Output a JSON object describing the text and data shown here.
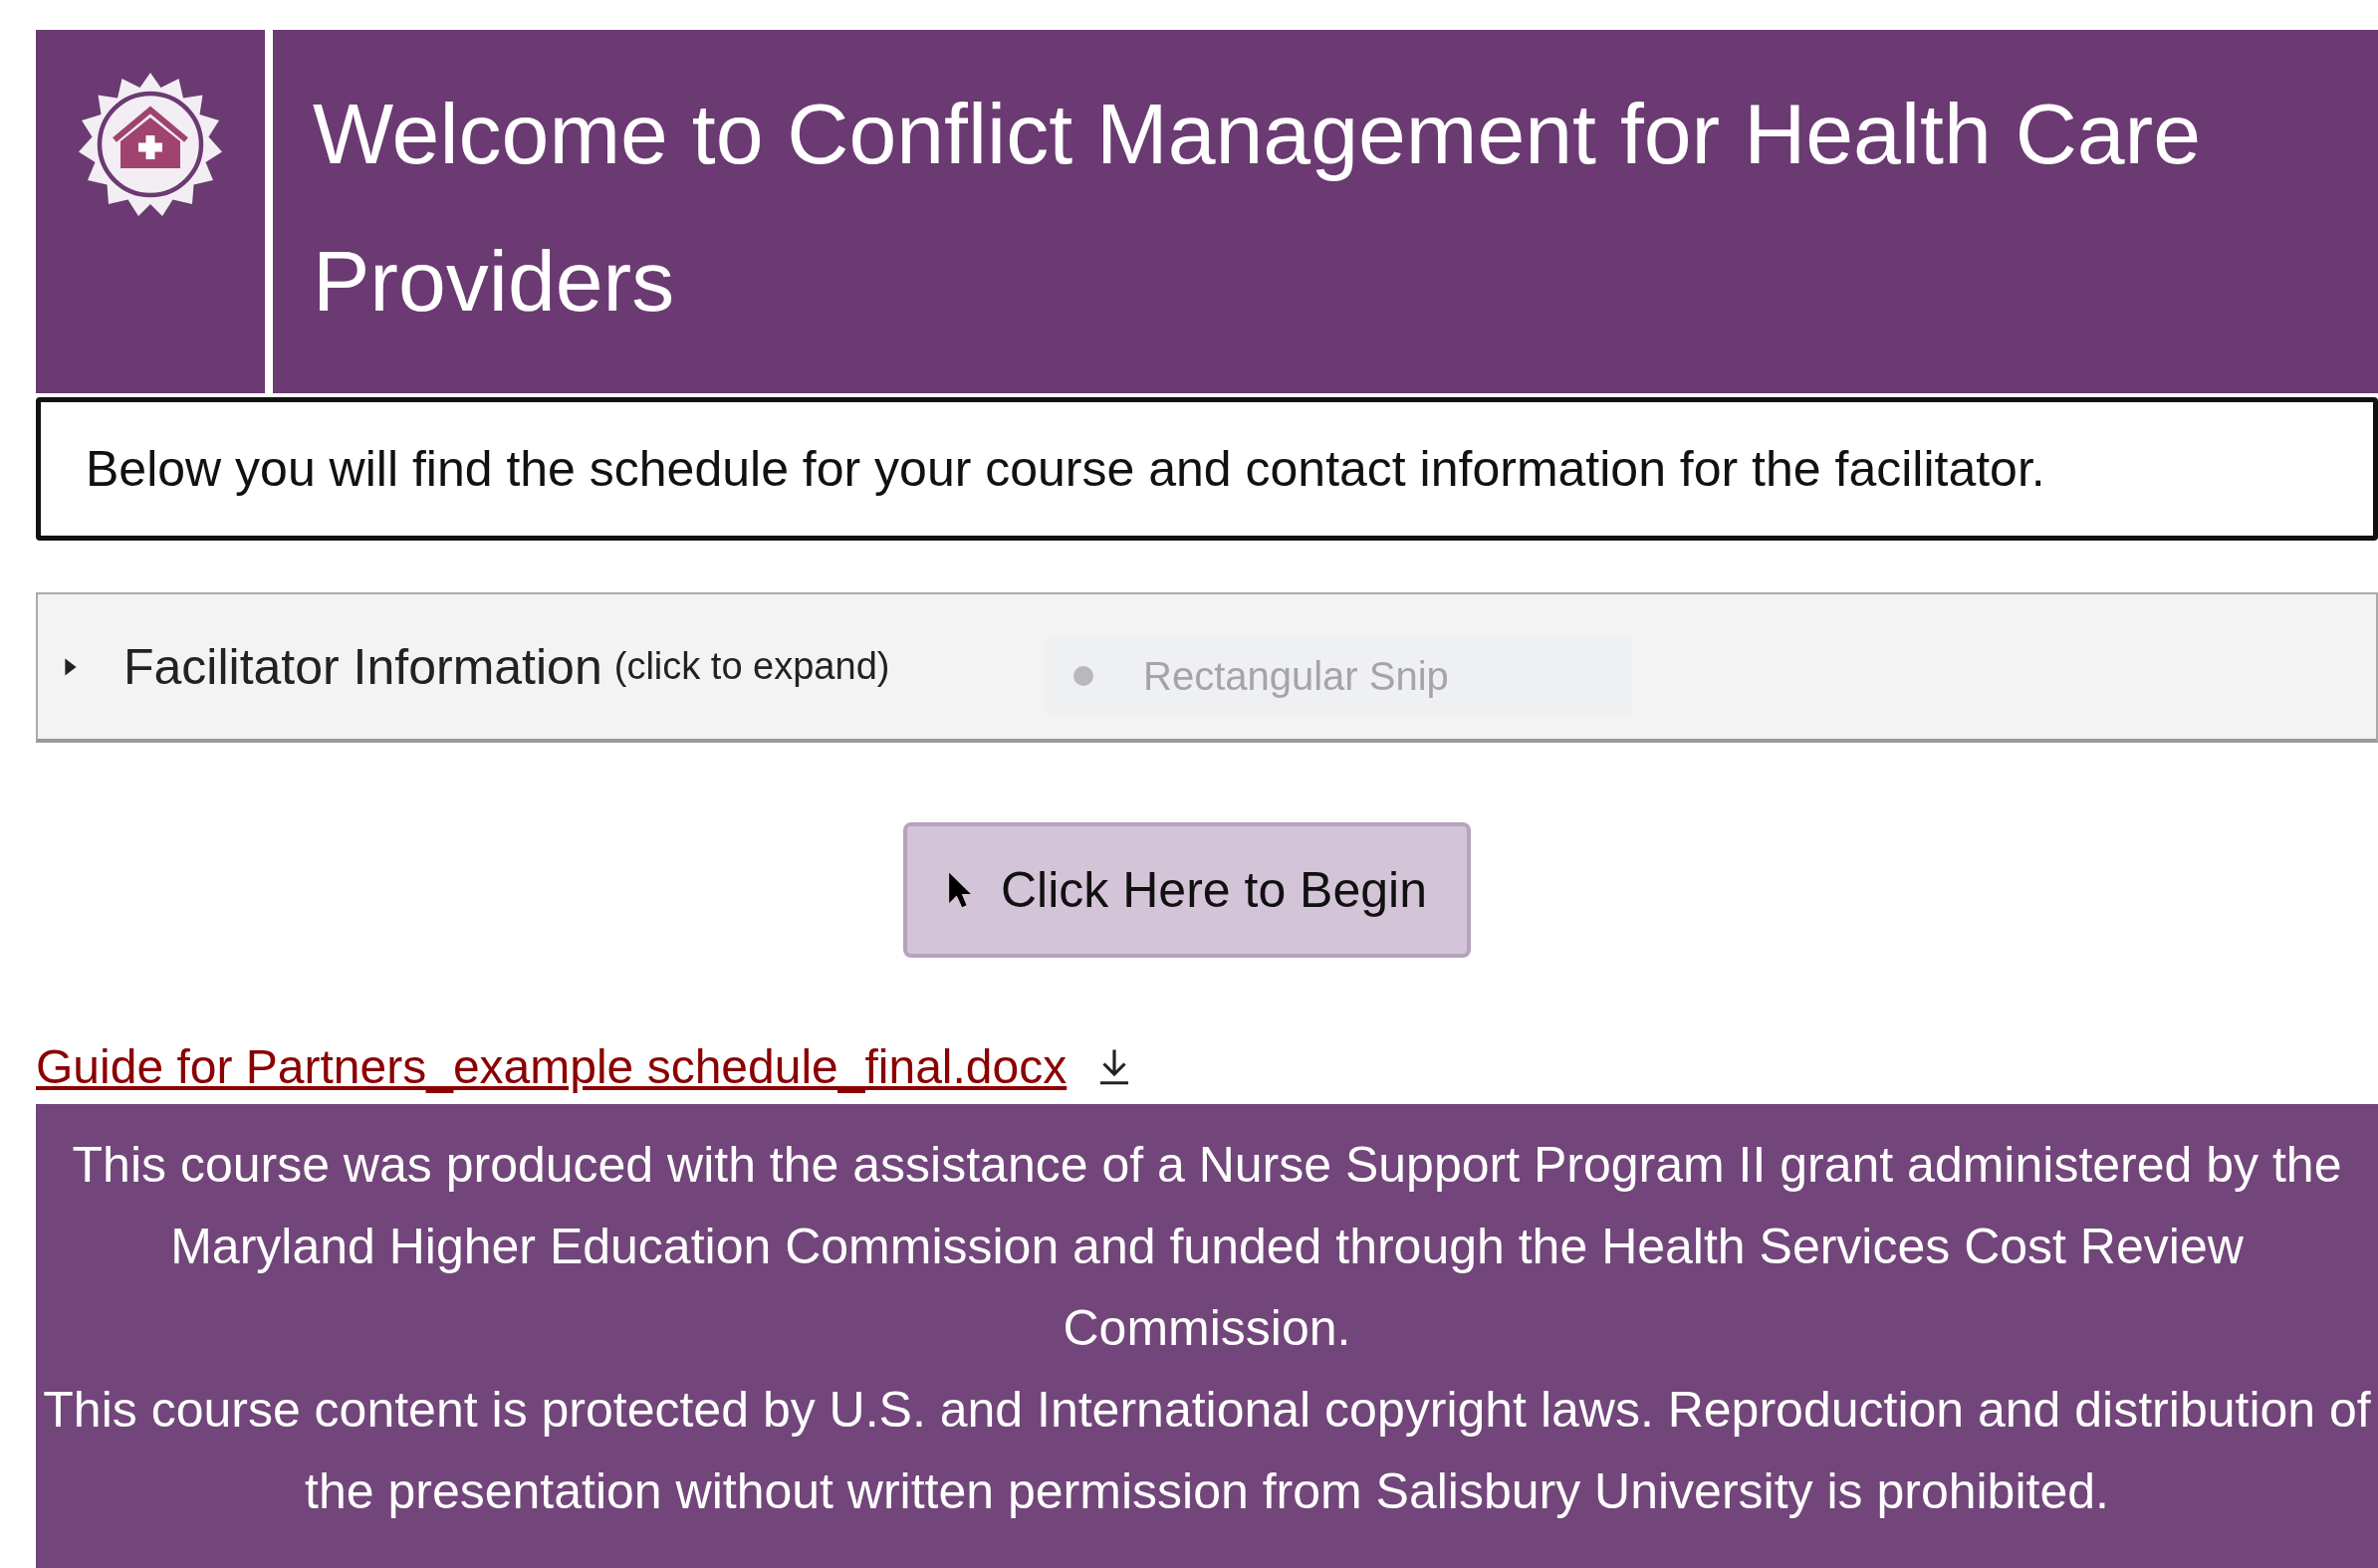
{
  "header": {
    "title": "Welcome to Conflict Management for Health Care Providers"
  },
  "intro": "Below you will find the schedule for your course and contact information for the facilitator.",
  "accordion": {
    "label": "Facilitator Information",
    "hint": "(click to expand)",
    "expanded": false
  },
  "snip_tooltip": "Rectangular Snip",
  "begin_button": "Click Here to Begin",
  "file_link": "Guide for Partners_example schedule_final.docx",
  "footer": [
    "This course was produced with the assistance of a Nurse Support Program II grant administered by the Maryland Higher Education Commission and funded through the Health Services Cost Review Commission.",
    "This course content is protected by U.S. and International copyright laws. Reproduction and distribution of the presentation without written permission from Salisbury University is prohibited."
  ]
}
